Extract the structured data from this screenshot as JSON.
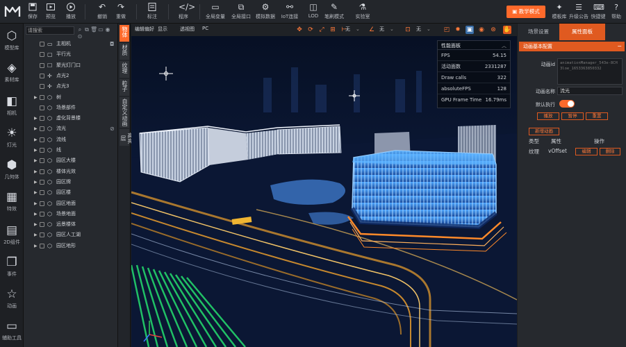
{
  "toolbar": {
    "buttons": [
      {
        "label": "保存",
        "icon": "save-icon"
      },
      {
        "label": "预览",
        "icon": "preview-icon"
      },
      {
        "label": "播放",
        "icon": "play-icon"
      },
      {
        "label": "撤销",
        "icon": "undo-icon"
      },
      {
        "label": "重做",
        "icon": "redo-icon"
      },
      {
        "label": "标注",
        "icon": "annotation-icon"
      },
      {
        "label": "程序",
        "icon": "code-icon"
      },
      {
        "label": "全局变量",
        "icon": "global-variable-icon"
      },
      {
        "label": "全局接口",
        "icon": "global-api-icon"
      },
      {
        "label": "模拟数据",
        "icon": "mock-data-icon"
      },
      {
        "label": "IoT连接",
        "icon": "iot-icon"
      },
      {
        "label": "LOD",
        "icon": "lod-icon"
      },
      {
        "label": "笔刷模式",
        "icon": "brush-icon"
      },
      {
        "label": "实验室",
        "icon": "lab-icon"
      }
    ],
    "teach_mode": "教学模式",
    "right_buttons": [
      {
        "label": "模板库",
        "icon": "template-icon"
      },
      {
        "label": "升级公告",
        "icon": "notice-icon"
      },
      {
        "label": "快捷键",
        "icon": "keyboard-icon"
      },
      {
        "label": "帮助",
        "icon": "help-icon"
      }
    ]
  },
  "rail": [
    {
      "label": "模型库",
      "icon": "cube-icon"
    },
    {
      "label": "素材库",
      "icon": "layers-icon"
    },
    {
      "label": "相机",
      "icon": "camera-icon"
    },
    {
      "label": "灯光",
      "icon": "light-icon"
    },
    {
      "label": "几何体",
      "icon": "geometry-icon"
    },
    {
      "label": "特效",
      "icon": "effect-icon"
    },
    {
      "label": "2D组件",
      "icon": "2d-component-icon"
    },
    {
      "label": "事件",
      "icon": "event-icon"
    },
    {
      "label": "动画",
      "icon": "star-icon"
    },
    {
      "label": "辅助工具",
      "icon": "tool-icon"
    }
  ],
  "tree": {
    "search_placeholder": "请搜索",
    "items": [
      {
        "label": "主相机",
        "icon": "camera",
        "arrow": false
      },
      {
        "label": "平行光",
        "icon": "light",
        "arrow": false
      },
      {
        "label": "聚光灯门口",
        "icon": "spot",
        "arrow": false
      },
      {
        "label": "点光2",
        "icon": "point",
        "arrow": false
      },
      {
        "label": "点光3",
        "icon": "point",
        "arrow": false
      },
      {
        "label": "树",
        "icon": "cube",
        "arrow": true
      },
      {
        "label": "场景部件",
        "icon": "cube",
        "arrow": false
      },
      {
        "label": "虚化背景楼",
        "icon": "cube",
        "arrow": true
      },
      {
        "label": "流光",
        "icon": "cube",
        "arrow": true
      },
      {
        "label": "流线",
        "icon": "cube",
        "arrow": true
      },
      {
        "label": "线",
        "icon": "cube",
        "arrow": true
      },
      {
        "label": "园区大楼",
        "icon": "cube",
        "arrow": true
      },
      {
        "label": "楼体光效",
        "icon": "cube",
        "arrow": true
      },
      {
        "label": "园区牌",
        "icon": "cube",
        "arrow": true
      },
      {
        "label": "园区楼",
        "icon": "cube",
        "arrow": true
      },
      {
        "label": "园区地面",
        "icon": "cube",
        "arrow": true
      },
      {
        "label": "场景地面",
        "icon": "cube",
        "arrow": true
      },
      {
        "label": "远景楼体",
        "icon": "cube",
        "arrow": true
      },
      {
        "label": "园区人工湖",
        "icon": "cube",
        "arrow": true
      },
      {
        "label": "园区地形",
        "icon": "cube",
        "arrow": true
      }
    ]
  },
  "vtabs": [
    "物体",
    "材质",
    "纹理",
    "粒子",
    "自定义动画",
    "高亮层"
  ],
  "viewport": {
    "menu_edit": "编辑偏好",
    "menu_display": "显示",
    "menu_perspective": "透视图",
    "menu_pc": "PC",
    "sel1": "无",
    "sel2": "无",
    "sel3": "无",
    "perf": {
      "title": "性能面板",
      "rows": [
        {
          "label": "FPS",
          "value": "54.15"
        },
        {
          "label": "活动面数",
          "value": "2331287"
        },
        {
          "label": "Draw calls",
          "value": "322"
        },
        {
          "label": "absoluteFPS",
          "value": "128"
        },
        {
          "label": "GPU Frame Time",
          "value": "16.79ms"
        }
      ]
    }
  },
  "rpanel": {
    "tab_scene": "场景设置",
    "tab_props": "属性面板",
    "section": "动画基本配置",
    "id_label": "动画id",
    "id_value": "animationManager_543e-8CH3loe_1653363850332",
    "name_label": "动画名称",
    "name_value": "流光",
    "default_label": "默认执行",
    "play": "播放",
    "pause": "暂停",
    "reset": "重置",
    "new_anim": "新增动画",
    "col_type": "类型",
    "col_attr": "属性",
    "col_op": "操作",
    "row_type": "纹理",
    "row_attr": "vOffset",
    "edit": "编辑",
    "delete": "删除"
  },
  "colors": {
    "accent": "#ff6a2b",
    "panel": "#26292e",
    "bg": "#1b1d21"
  }
}
